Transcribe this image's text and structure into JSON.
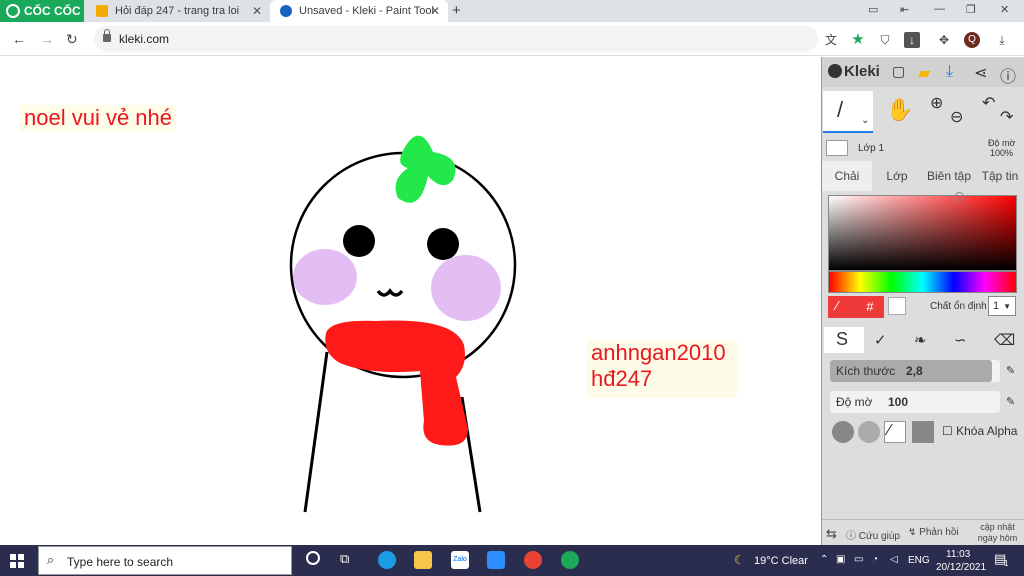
{
  "browser": {
    "logo_text": "CỐC CỐC",
    "tabs": [
      {
        "title": "Hỏi đáp 247 - trang tra loi"
      },
      {
        "title": "Unsaved - Kleki - Paint Tool"
      }
    ],
    "new_tab": "+",
    "url": "kleki.com",
    "profile_initial": "Q"
  },
  "canvas": {
    "text1": "noel vui vẻ nhé",
    "text2_line1": "anhngan2010",
    "text2_line2": "hđ247",
    "colors": {
      "text": "#e8191e",
      "scarf": "#ff1a1a",
      "leaf": "#22e84a",
      "cheek": "#d9a7f0"
    }
  },
  "kleki": {
    "logo": "Kleki",
    "layer_name": "Lớp 1",
    "opacity_label": "Độ mờ",
    "opacity_value": "100%",
    "tabs": [
      "Chải",
      "Lớp",
      "Biên tập",
      "Tập tin"
    ],
    "stabilizer_label": "Chất ổn định",
    "stabilizer_value": "1",
    "hex_symbol": "#",
    "size_label": "Kích thước",
    "size_value": "2,8",
    "size_fraction": 0.07,
    "brush_opacity_label": "Độ mờ",
    "brush_opacity_value": "100",
    "lock_alpha_label": "Khóa Alpha",
    "footer_help": "Cứu giúp",
    "footer_feedback": "Phản hồi",
    "footer_update_line1": "cập nhật",
    "footer_update_line2": "ngày hôm qua",
    "primary_color": "#f03a3a"
  },
  "taskbar": {
    "search_placeholder": "Type here to search",
    "weather": "19°C  Clear",
    "lang": "ENG",
    "time": "11:03",
    "date": "20/12/2021",
    "notif_count": "1"
  }
}
